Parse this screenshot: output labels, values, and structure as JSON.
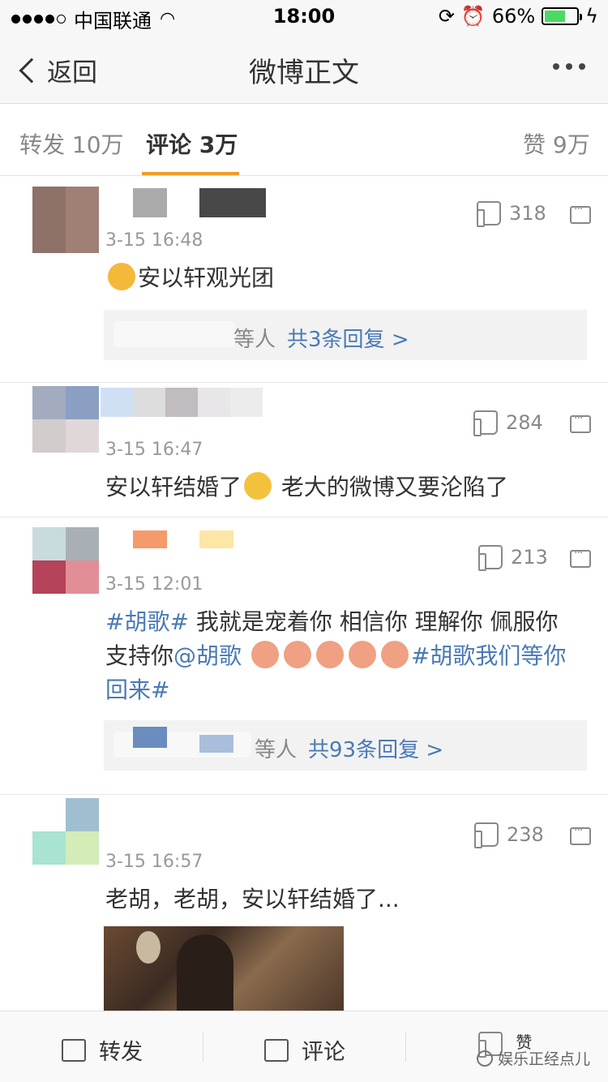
{
  "status_bar": {
    "carrier": "中国联通",
    "time": "18:00",
    "battery": "66%"
  },
  "nav": {
    "back_label": "返回",
    "title": "微博正文"
  },
  "tabs": [
    {
      "label": "转发",
      "count": "10万"
    },
    {
      "label": "评论",
      "count": "3万"
    },
    {
      "label": "赞",
      "count": "9万"
    }
  ],
  "comments": [
    {
      "likes": "318",
      "date": "3-15 16:48",
      "text": "安以轩观光团",
      "reply_suffix": "等人",
      "reply_count": "共3条回复 >"
    },
    {
      "likes": "284",
      "date": "3-15 16:47",
      "text_a": "安以轩结婚了",
      "text_b": "老大的微博又要沦陷了"
    },
    {
      "likes": "213",
      "date": "3-15 12:01",
      "topic1": "#胡歌#",
      "body1": "我就是宠着你  相信你  理解你  佩服你支持你",
      "mention": "@胡歌",
      "topic2": "#胡歌我们等你回来#",
      "reply_suffix": "等人",
      "reply_count": "共93条回复 >"
    },
    {
      "likes": "238",
      "date": "3-15 16:57",
      "text": "老胡，老胡，安以轩结婚了..."
    }
  ],
  "bottom": {
    "repost": "转发",
    "comment": "评论",
    "like": "赞",
    "watermark": "娱乐正经点儿"
  },
  "colors": {
    "accent": "#f09a28",
    "link": "#4a7ab5"
  }
}
